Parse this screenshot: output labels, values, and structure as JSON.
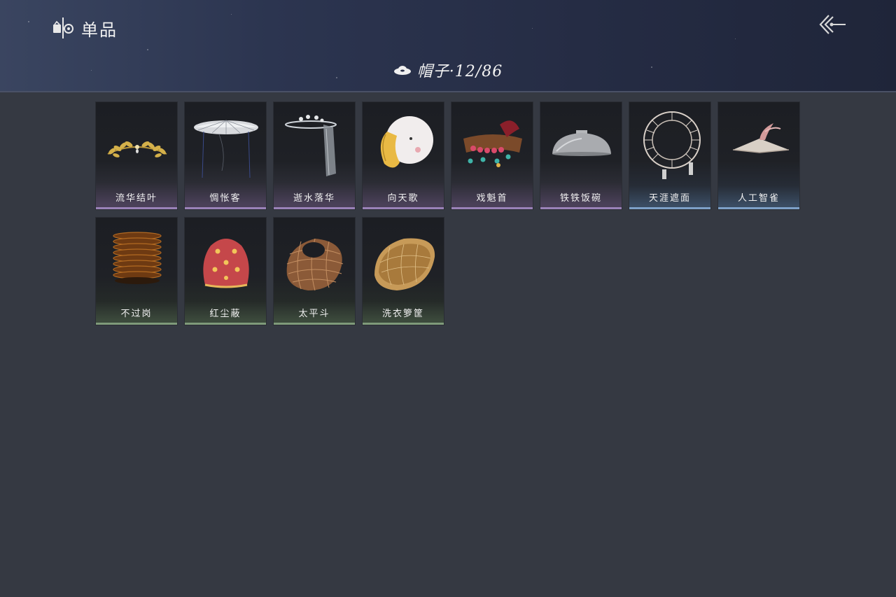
{
  "header": {
    "section_title": "单品",
    "section_icon": "wardrobe-icon",
    "back_icon": "back-arrow-icon"
  },
  "category": {
    "icon": "hat-icon",
    "label": "帽子·12/86"
  },
  "items": [
    {
      "name": "流华结叶",
      "icon": "golden-laurel-crown",
      "rarity": "purple"
    },
    {
      "name": "惆怅客",
      "icon": "veiled-bamboo-hat",
      "rarity": "purple"
    },
    {
      "name": "逝水落华",
      "icon": "ornate-veil-hairpiece",
      "rarity": "purple"
    },
    {
      "name": "向天歌",
      "icon": "goose-hood",
      "rarity": "purple"
    },
    {
      "name": "戏魁首",
      "icon": "opera-headdress",
      "rarity": "purple"
    },
    {
      "name": "铁铁饭碗",
      "icon": "iron-bowl-hat",
      "rarity": "purple"
    },
    {
      "name": "天涯遮面",
      "icon": "frame-umbrella-hat",
      "rarity": "blue"
    },
    {
      "name": "人工智雀",
      "icon": "bird-flat-hat",
      "rarity": "blue"
    },
    {
      "name": "不过岗",
      "icon": "stacked-bowls-hat",
      "rarity": "green"
    },
    {
      "name": "红尘蔽",
      "icon": "red-embroidered-hood",
      "rarity": "green"
    },
    {
      "name": "太平斗",
      "icon": "wicker-basket-hat",
      "rarity": "green"
    },
    {
      "name": "洗衣箩筐",
      "icon": "laundry-basket-hat",
      "rarity": "green"
    }
  ]
}
